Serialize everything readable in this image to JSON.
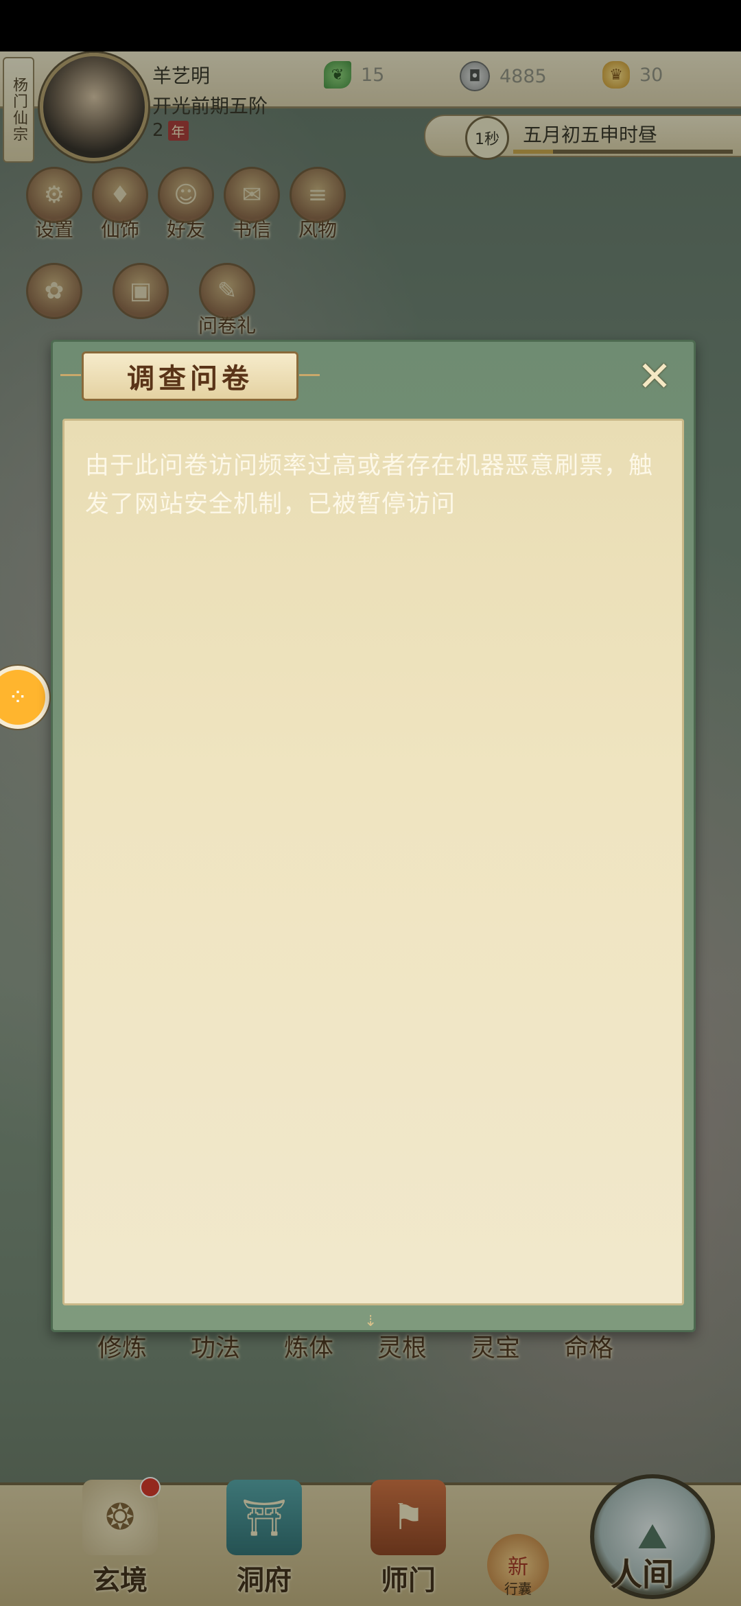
{
  "sect": "杨门仙宗",
  "player": {
    "name": "羊艺明",
    "rank": "开光前期五阶",
    "years": "2",
    "years_badge": "年"
  },
  "resources": {
    "jade": "15",
    "coin": "4885",
    "ingot": "30"
  },
  "time": {
    "speed": "1秒",
    "date": "五月初五申时昼",
    "progress": 0.18
  },
  "top_icons": [
    {
      "label": "设置",
      "icon": "gear-icon"
    },
    {
      "label": "仙饰",
      "icon": "robe-icon"
    },
    {
      "label": "好友",
      "icon": "friends-icon"
    },
    {
      "label": "书信",
      "icon": "letter-icon"
    },
    {
      "label": "风物",
      "icon": "scroll-icon"
    }
  ],
  "second_icons": [
    {
      "label": "...",
      "icon": "gift-icon"
    },
    {
      "label": "...",
      "icon": "chest-icon"
    },
    {
      "label": "问卷礼",
      "icon": "survey-gift-icon"
    }
  ],
  "dialog": {
    "title": "调查问卷",
    "close": "✕",
    "message": "由于此问卷访问频率过高或者存在机器恶意刷票，触发了网站安全机制，已被暂停访问"
  },
  "menu_row": [
    "修炼",
    "功法",
    "炼体",
    "灵根",
    "灵宝",
    "命格"
  ],
  "bottom_nav": {
    "xuanjing": "玄境",
    "dongfu": "洞府",
    "shimen": "师门",
    "xingnang_badge": "新",
    "xingnang": "行囊",
    "renjian": "人间"
  }
}
